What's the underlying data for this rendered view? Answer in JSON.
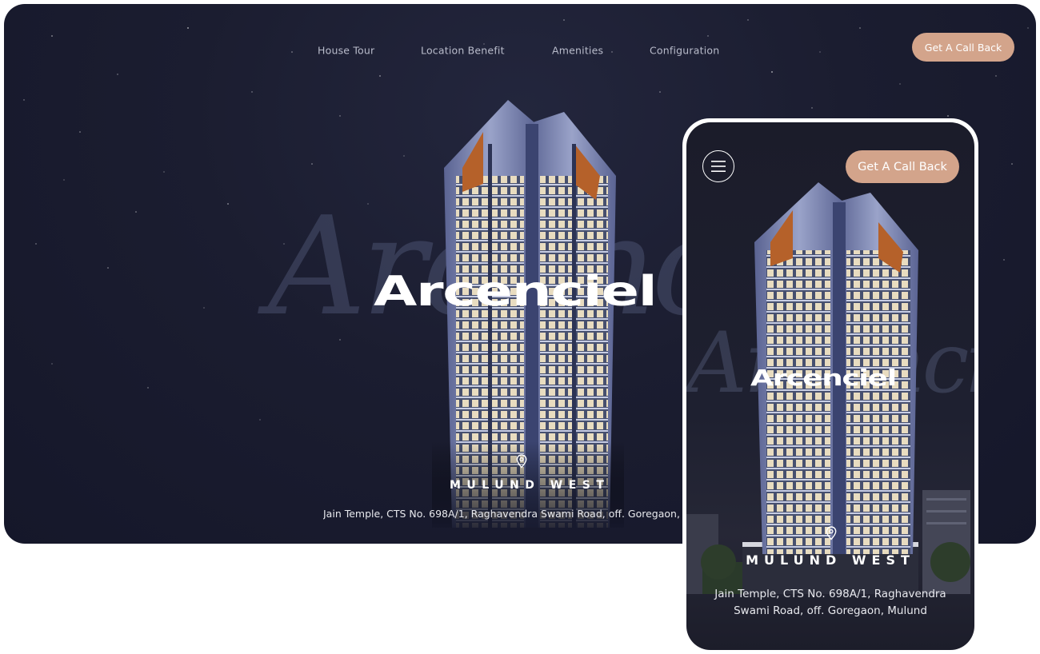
{
  "desktop": {
    "nav": {
      "links": [
        "House Tour",
        "Location Benefit",
        "Amenities",
        "Configuration"
      ],
      "cta_label": "Get A Call Back"
    },
    "hero": {
      "brand": "Arcenciel",
      "location": "MULUND WEST",
      "address": "Jain Temple, CTS No. 698A/1, Raghavendra Swami Road, off. Goregaon, M"
    }
  },
  "mobile": {
    "cta_label": "Get A Call Back",
    "hero": {
      "brand": "Arcenciel",
      "location": "MULUND WEST",
      "address": "Jain Temple, CTS No. 698A/1, Raghavendra Swami Road, off. Goregaon, Mulund"
    }
  },
  "colors": {
    "background": "#1b1d30",
    "accent": "#d3a48b",
    "text": "#ffffff",
    "nav_text": "#b9bccb"
  },
  "icons": [
    "location-pin-icon",
    "hamburger-menu-icon"
  ]
}
